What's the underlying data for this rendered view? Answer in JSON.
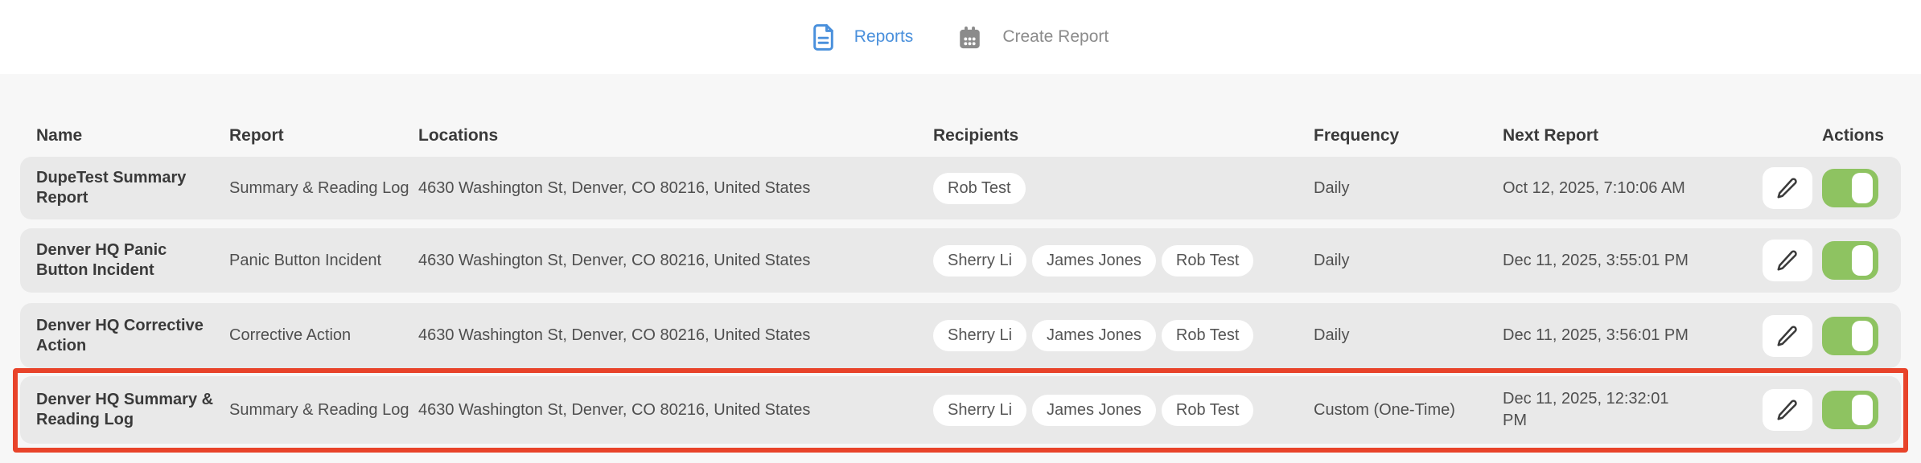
{
  "tabs": [
    {
      "label": "Reports",
      "icon": "document-icon",
      "active": true
    },
    {
      "label": "Create Report",
      "icon": "calendar-icon",
      "active": false
    }
  ],
  "table": {
    "columns": [
      "Name",
      "Report",
      "Locations",
      "Recipients",
      "Frequency",
      "Next Report",
      "Actions"
    ],
    "rows": [
      {
        "name": "DupeTest Summary Report",
        "report": "Summary & Reading Log",
        "locations": "4630 Washington St, Denver, CO 80216, United States",
        "recipients": [
          "Rob Test"
        ],
        "frequency": "Daily",
        "next_report": "Oct 12, 2025, 7:10:06 AM",
        "enabled": true,
        "highlighted": false
      },
      {
        "name": "Denver HQ Panic Button Incident",
        "report": "Panic Button Incident",
        "locations": "4630 Washington St, Denver, CO 80216, United States",
        "recipients": [
          "Sherry Li",
          "James Jones",
          "Rob Test"
        ],
        "frequency": "Daily",
        "next_report": "Dec 11, 2025, 3:55:01 PM",
        "enabled": true,
        "highlighted": false
      },
      {
        "name": "Denver HQ Corrective Action",
        "report": "Corrective Action",
        "locations": "4630 Washington St, Denver, CO 80216, United States",
        "recipients": [
          "Sherry Li",
          "James Jones",
          "Rob Test"
        ],
        "frequency": "Daily",
        "next_report": "Dec 11, 2025, 3:56:01 PM",
        "enabled": true,
        "highlighted": false
      },
      {
        "name": "Denver HQ Summary & Reading Log",
        "report": "Summary & Reading Log",
        "locations": "4630 Washington St, Denver, CO 80216, United States",
        "recipients": [
          "Sherry Li",
          "James Jones",
          "Rob Test"
        ],
        "frequency": "Custom (One-Time)",
        "next_report": "Dec 11, 2025, 12:32:01 PM",
        "enabled": true,
        "highlighted": true
      }
    ]
  },
  "colors": {
    "accent_blue": "#4a90dc",
    "inactive_gray": "#8b8b8b",
    "toggle_green": "#8ec361",
    "highlight_red": "#e8432a",
    "row_background": "#e9e9e9",
    "page_background": "#f7f7f7"
  }
}
